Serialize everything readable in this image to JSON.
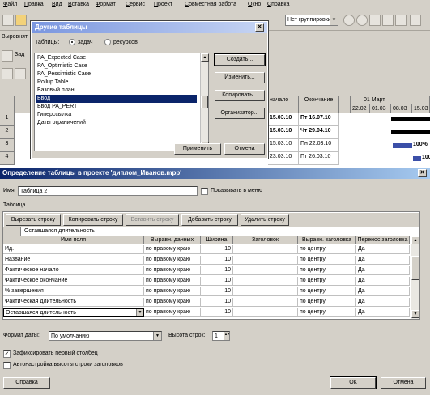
{
  "menu": [
    "Файл",
    "Правка",
    "Вид",
    "Вставка",
    "Формат",
    "Сервис",
    "Проект",
    "Совместная работа",
    "Окно",
    "Справка"
  ],
  "toolbar": {
    "grouping": "Нет группировки",
    "left_label_1": "Выровнят",
    "left_label_2": "Зад"
  },
  "bg_sheet": {
    "headers": [
      "начало",
      "Окончание"
    ],
    "timescale": {
      "month": "01 Март",
      "days": [
        "22.02",
        "01.03",
        "08.03",
        "15.03"
      ]
    },
    "rows": [
      {
        "num": "1",
        "start": "15.03.10",
        "end": "Пт 16.07.10"
      },
      {
        "num": "2",
        "start": "15.03.10",
        "end": "Чт 29.04.10"
      },
      {
        "num": "3",
        "start": "15.03.10",
        "end": "Пн 22.03.10",
        "pct": "100%"
      },
      {
        "num": "4",
        "start": "23.03.10",
        "end": "Пт 26.03.10",
        "pct": "100"
      }
    ]
  },
  "other_tables": {
    "title": "Другие таблицы",
    "tables_label": "Таблицы:",
    "radio_tasks": "задач",
    "radio_resources": "ресурсов",
    "items": [
      "PA_Expected Case",
      "PA_Optimistic Case",
      "PA_Pessimistic Case",
      "Rollup Table",
      "Базовый план",
      "Ввод",
      "Ввод PA_PERT",
      "Гиперссылка",
      "Даты ограничений"
    ],
    "selected_index": 5,
    "buttons": {
      "create": "Создать...",
      "edit": "Изменить...",
      "copy": "Копировать...",
      "organizer": "Организатор...",
      "apply": "Применить",
      "cancel": "Отмена"
    }
  },
  "table_def": {
    "title": "Определение таблицы в проекте 'диплом_Иванов.mpp'",
    "name_label": "Имя:",
    "name_value": "Таблица 2",
    "show_in_menu": "Показывать в меню",
    "table_label": "Таблица",
    "buttons": {
      "cut_row": "Вырезать строку",
      "copy_row": "Копировать строку",
      "paste_row": "Вставить строку",
      "add_row": "Добавить строку",
      "delete_row": "Удалить строку"
    },
    "edit_value": "Оставшаяся длительность",
    "columns": [
      "Имя поля",
      "Выравн. данных",
      "Ширина",
      "Заголовок",
      "Выравн. заголовка",
      "Перенос заголовка"
    ],
    "rows": [
      [
        "Ид.",
        "по правому краю",
        "10",
        "",
        "по центру",
        "Да"
      ],
      [
        "Название",
        "по правому краю",
        "10",
        "",
        "по центру",
        "Да"
      ],
      [
        "Фактическое начало",
        "по правому краю",
        "10",
        "",
        "по центру",
        "Да"
      ],
      [
        "Фактическое окончание",
        "по правому краю",
        "10",
        "",
        "по центру",
        "Да"
      ],
      [
        "% завершения",
        "по правому краю",
        "10",
        "",
        "по центру",
        "Да"
      ],
      [
        "Фактическая длительность",
        "по правому краю",
        "10",
        "",
        "по центру",
        "Да"
      ],
      [
        "Оставшаяся длительность",
        "по правому краю",
        "10",
        "",
        "по центру",
        "Да"
      ]
    ],
    "date_format_label": "Формат даты:",
    "date_format_value": "По умолчанию",
    "row_height_label": "Высота строк:",
    "row_height_value": "1",
    "lock_first_col": "Зафиксировать первый столбец",
    "auto_header_height": "Автонастройка высоты строки заголовков",
    "help": "Справка",
    "ok": "ОК",
    "cancel": "Отмена"
  }
}
